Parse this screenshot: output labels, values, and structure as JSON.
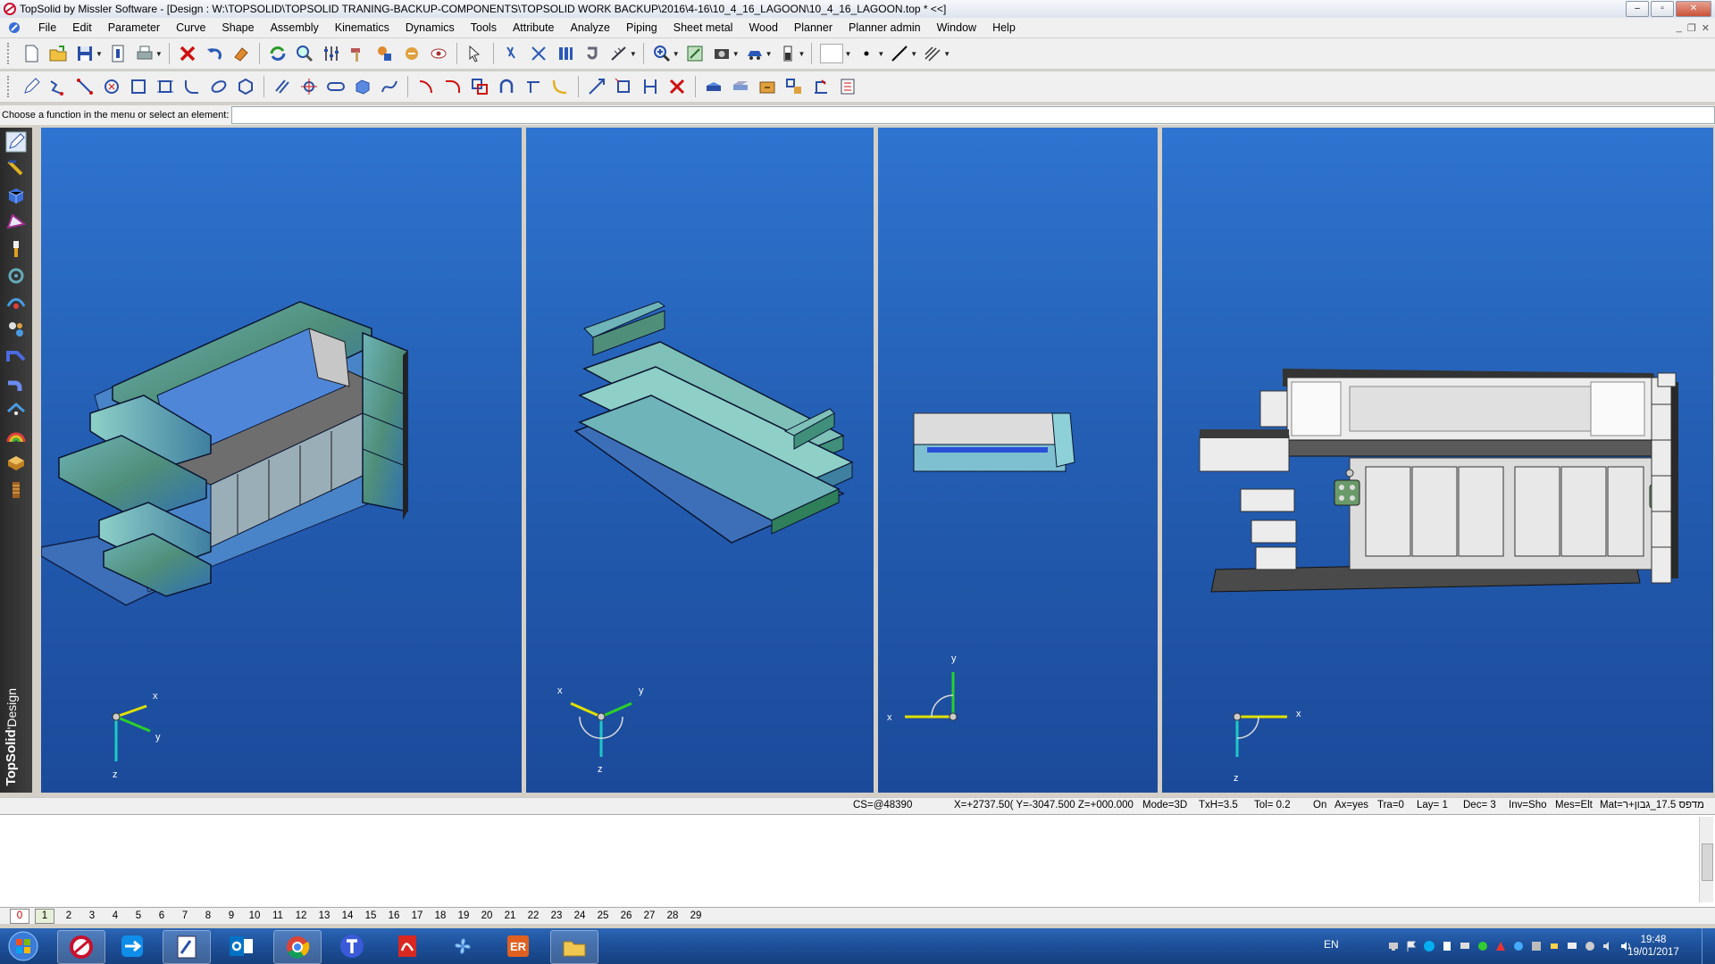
{
  "window": {
    "title": "TopSolid by Missler Software - [Design : W:\\TOPSOLID\\TOPSOLID TRANING-BACKUP-COMPONENTS\\TOPSOLID WORK BACKUP\\2016\\4-16\\10_4_16_LAGOON\\10_4_16_LAGOON.top *  <<]",
    "buttons": [
      "–",
      "▫",
      "✕"
    ]
  },
  "menu": [
    "File",
    "Edit",
    "Parameter",
    "Curve",
    "Shape",
    "Assembly",
    "Kinematics",
    "Dynamics",
    "Tools",
    "Attribute",
    "Analyze",
    "Piping",
    "Sheet metal",
    "Wood",
    "Planner",
    "Planner admin",
    "Window",
    "Help"
  ],
  "prompt": {
    "label": "Choose a function in the menu or select an element:",
    "value": ""
  },
  "left_toolbar": {
    "brand_bold": "TopSolid",
    "brand_rest": "'Design"
  },
  "viewports": [
    {
      "axes": [
        "x",
        "y",
        "z"
      ]
    },
    {
      "axes": [
        "x",
        "y",
        "z"
      ]
    },
    {
      "axes": [
        "y",
        "x"
      ]
    },
    {
      "axes": [
        "x",
        "z"
      ]
    }
  ],
  "status": {
    "cs": "CS=@48390",
    "coords": "X=+2737.50( Y=-3047.500 Z=+000.000",
    "mode": "Mode=3D",
    "txh": "TxH=3.5",
    "tol": "Tol= 0.2",
    "on": "On",
    "ax": "Ax=yes",
    "tra": "Tra=0",
    "lay": "Lay= 1",
    "dec": "Dec= 3",
    "inv": "Inv=Sho",
    "mes": "Mes=Elt",
    "mat": "Mat=מדפס 17.5_גבון+ר"
  },
  "layers": [
    "0",
    "1",
    "2",
    "3",
    "4",
    "5",
    "6",
    "7",
    "8",
    "9",
    "10",
    "11",
    "12",
    "13",
    "14",
    "15",
    "16",
    "17",
    "18",
    "19",
    "20",
    "21",
    "22",
    "23",
    "24",
    "25",
    "26",
    "27",
    "28",
    "29"
  ],
  "taskbar": {
    "lang": "EN",
    "time": "19:48",
    "date": "19/01/2017"
  }
}
